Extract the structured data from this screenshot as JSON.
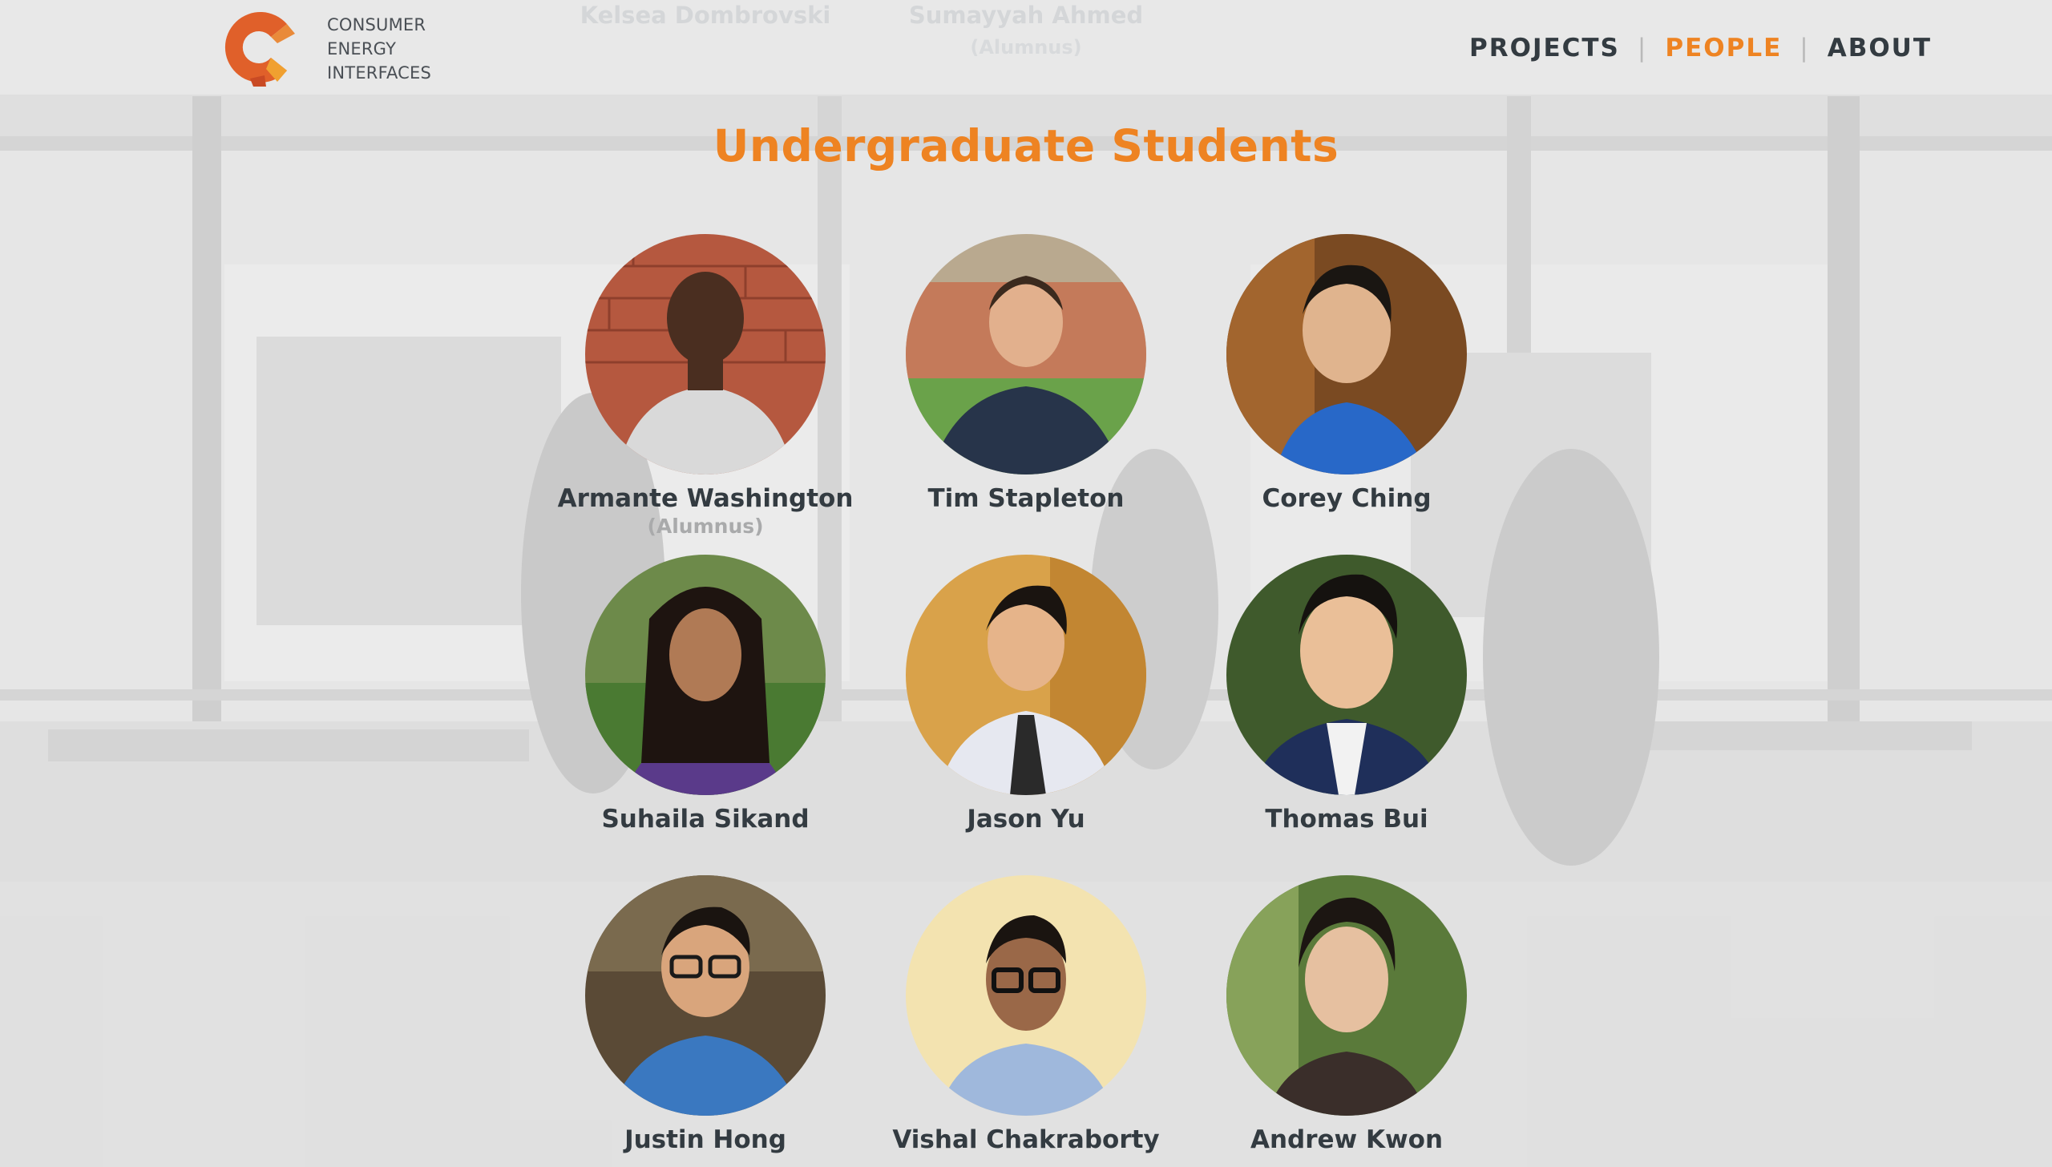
{
  "logo": {
    "lines": [
      "CONSUMER",
      "ENERGY",
      "INTERFACES"
    ],
    "accent": "#e0602a"
  },
  "previous_section": {
    "names": [
      "Kelsea Dombrovski",
      "Sumayyah Ahmed"
    ],
    "status": "(Alumnus)"
  },
  "nav": {
    "items": [
      "PROJECTS",
      "PEOPLE",
      "ABOUT"
    ],
    "separator": "|",
    "active": "PEOPLE"
  },
  "colors": {
    "accent": "#ee8322",
    "text": "#333b41",
    "muted": "#a9aaab"
  },
  "section": {
    "title": "Undergraduate Students",
    "people": [
      {
        "name": "Armante Washington",
        "status": "(Alumnus)"
      },
      {
        "name": "Tim Stapleton",
        "status": ""
      },
      {
        "name": "Corey Ching",
        "status": ""
      },
      {
        "name": "Suhaila Sikand",
        "status": ""
      },
      {
        "name": "Jason Yu",
        "status": ""
      },
      {
        "name": "Thomas Bui",
        "status": ""
      },
      {
        "name": "Justin Hong",
        "status": ""
      },
      {
        "name": "Vishal Chakraborty",
        "status": ""
      },
      {
        "name": "Andrew Kwon",
        "status": ""
      }
    ]
  }
}
